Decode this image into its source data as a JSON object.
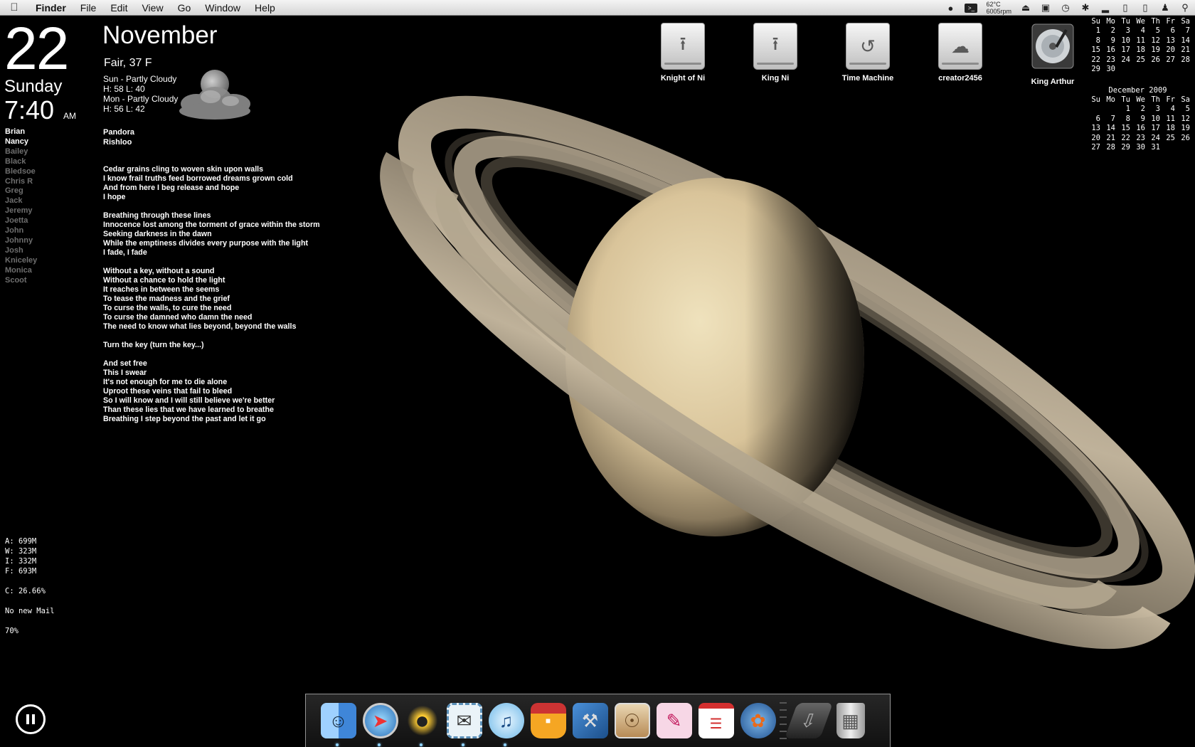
{
  "menubar": {
    "app": "Finder",
    "menus": [
      "File",
      "Edit",
      "View",
      "Go",
      "Window",
      "Help"
    ],
    "temp": "62°C",
    "fan": "6005rpm"
  },
  "clock": {
    "day": "22",
    "weekday": "Sunday",
    "time": "7:40",
    "ampm": "AM"
  },
  "people": [
    {
      "name": "Brian",
      "online": true
    },
    {
      "name": "Nancy",
      "online": true
    },
    {
      "name": "Bailey",
      "online": false
    },
    {
      "name": "Black",
      "online": false
    },
    {
      "name": "Bledsoe",
      "online": false
    },
    {
      "name": "Chris R",
      "online": false
    },
    {
      "name": "Greg",
      "online": false
    },
    {
      "name": "Jack",
      "online": false
    },
    {
      "name": "Jeremy",
      "online": false
    },
    {
      "name": "Joetta",
      "online": false
    },
    {
      "name": "John",
      "online": false
    },
    {
      "name": "Johnny",
      "online": false
    },
    {
      "name": "Josh",
      "online": false
    },
    {
      "name": "Kniceley",
      "online": false
    },
    {
      "name": "Monica",
      "online": false
    },
    {
      "name": "Scoot",
      "online": false
    }
  ],
  "stats": {
    "a": "A: 699M",
    "w": "W: 323M",
    "i": "I: 332M",
    "f": "F: 693M",
    "cpu": "C: 26.66%",
    "mail": "No new Mail",
    "battery": "70%"
  },
  "weather": {
    "month": "November",
    "current": "Fair, 37 F",
    "forecast": [
      "Sun - Partly Cloudy",
      "H: 58  L: 40",
      "Mon - Partly Cloudy",
      "H: 56  L: 42"
    ]
  },
  "music": {
    "track": "Pandora",
    "artist": "Rishloo"
  },
  "lyrics": "Cedar grains cling to woven skin upon walls\nI know frail truths feed borrowed dreams grown cold\nAnd from here I beg release and hope\nI hope\n\nBreathing through these lines\nInnocence lost among the torment of grace within the storm\nSeeking darkness in the dawn\nWhile the emptiness divides every purpose with the light\nI fade, I fade\n\nWithout a key, without a sound\nWithout a chance to hold the light\nIt reaches in between the seems\nTo tease the madness and the grief\nTo curse the walls, to cure the need\nTo curse the damned who damn the need\nThe need to know what lies beyond, beyond the walls\n\nTurn the key (turn the key...)\n\nAnd set free\nThis I swear\nIt's not enough for me to die alone\nUproot these veins that fail to bleed\nSo I will know and I will still believe we're better\nThan these lies that we have learned to breathe\nBreathing I step beyond the past and let it go",
  "desktop_icons": [
    {
      "label": "Knight of Ni",
      "icon": "usb-drive-icon"
    },
    {
      "label": "King Ni",
      "icon": "usb-drive-icon"
    },
    {
      "label": "Time Machine",
      "icon": "time-machine-drive-icon"
    },
    {
      "label": "creator2456",
      "icon": "cloud-drive-icon"
    },
    {
      "label": "King Arthur",
      "icon": "hard-drive-icon"
    }
  ],
  "calendar": {
    "weekdays": [
      "Su",
      "Mo",
      "Tu",
      "We",
      "Th",
      "Fr",
      "Sa"
    ],
    "current_weeks": [
      [
        "1",
        "2",
        "3",
        "4",
        "5",
        "6",
        "7"
      ],
      [
        "8",
        "9",
        "10",
        "11",
        "12",
        "13",
        "14"
      ],
      [
        "15",
        "16",
        "17",
        "18",
        "19",
        "20",
        "21"
      ],
      [
        "22",
        "23",
        "24",
        "25",
        "26",
        "27",
        "28"
      ],
      [
        "29",
        "30",
        "",
        "",
        "",
        "",
        ""
      ]
    ],
    "next_title": "December 2009",
    "next_weeks": [
      [
        "",
        "",
        "1",
        "2",
        "3",
        "4",
        "5"
      ],
      [
        "6",
        "7",
        "8",
        "9",
        "10",
        "11",
        "12"
      ],
      [
        "13",
        "14",
        "15",
        "16",
        "17",
        "18",
        "19"
      ],
      [
        "20",
        "21",
        "22",
        "23",
        "24",
        "25",
        "26"
      ],
      [
        "27",
        "28",
        "29",
        "30",
        "31",
        "",
        ""
      ]
    ]
  },
  "dock": [
    {
      "icon": "finder-icon",
      "running": true
    },
    {
      "icon": "safari-icon",
      "running": true
    },
    {
      "icon": "adium-icon",
      "running": true
    },
    {
      "icon": "mail-icon",
      "running": true
    },
    {
      "icon": "itunes-icon",
      "running": true
    },
    {
      "icon": "jar-icon",
      "running": false
    },
    {
      "icon": "xcode-icon",
      "running": false
    },
    {
      "icon": "preview-icon",
      "running": false
    },
    {
      "icon": "design-tools-icon",
      "running": false
    },
    {
      "icon": "checklist-icon",
      "running": false
    },
    {
      "icon": "firefox-icon",
      "running": false
    },
    {
      "icon": "downloads-stack-icon",
      "running": false
    },
    {
      "icon": "trash-icon",
      "running": false
    }
  ]
}
